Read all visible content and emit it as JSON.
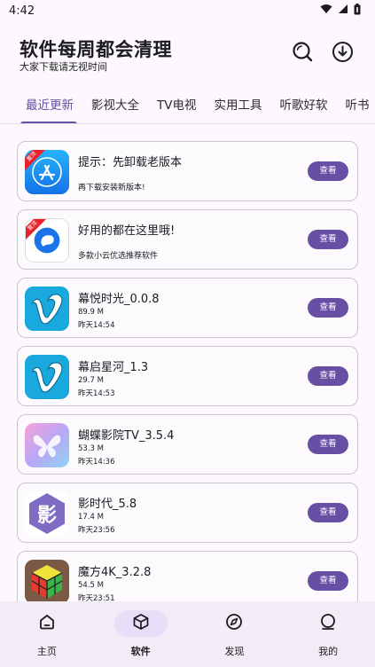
{
  "status_bar": {
    "time": "4:42",
    "icons": [
      "wifi-icon",
      "signal-icon",
      "battery-icon"
    ]
  },
  "header": {
    "title": "软件每周都会清理",
    "subtitle": "大家下载请无视时间",
    "icons": [
      "search-icon",
      "download-icon"
    ]
  },
  "tabs": [
    {
      "label": "最近更新",
      "active": true
    },
    {
      "label": "影视大全",
      "active": false
    },
    {
      "label": "TV电视",
      "active": false
    },
    {
      "label": "实用工具",
      "active": false
    },
    {
      "label": "听歌好软",
      "active": false
    },
    {
      "label": "听书",
      "active": false
    }
  ],
  "list": {
    "button_label": "查看",
    "items": [
      {
        "title": "提示：先卸载老版本",
        "subtitle": "再下载安装新版本!",
        "icon": "app-store-icon",
        "badge": "置顶"
      },
      {
        "title": "好用的都在这里哦!",
        "subtitle": "多款小云优选推荐软件",
        "icon": "cloud-chat-icon",
        "badge": "置顶"
      },
      {
        "title": "幕悦时光_0.0.8",
        "size": "89.9 M",
        "time": "昨天14:54",
        "icon": "vimeo-icon"
      },
      {
        "title": "幕启星河_1.3",
        "size": "29.7 M",
        "time": "昨天14:53",
        "icon": "vimeo-icon"
      },
      {
        "title": "蝴蝶影院TV_3.5.4",
        "size": "53.3 M",
        "time": "昨天14:36",
        "icon": "butterfly-icon"
      },
      {
        "title": "影时代_5.8",
        "size": "17.4 M",
        "time": "昨天23:56",
        "icon": "hexagon-ying-icon",
        "icon_text": "影"
      },
      {
        "title": "魔方4K_3.2.8",
        "size": "54.5 M",
        "time": "昨天23:51",
        "icon": "cube-icon"
      }
    ]
  },
  "bottom_nav": [
    {
      "label": "主页",
      "icon": "home-icon",
      "active": false
    },
    {
      "label": "软件",
      "icon": "box-icon",
      "active": true
    },
    {
      "label": "发现",
      "icon": "compass-icon",
      "active": false
    },
    {
      "label": "我的",
      "icon": "profile-icon",
      "active": false
    }
  ],
  "colors": {
    "accent": "#6750a4",
    "badge": "#e8212d",
    "nav_bg": "#f2ecf6",
    "active_pill": "#e8def8"
  }
}
